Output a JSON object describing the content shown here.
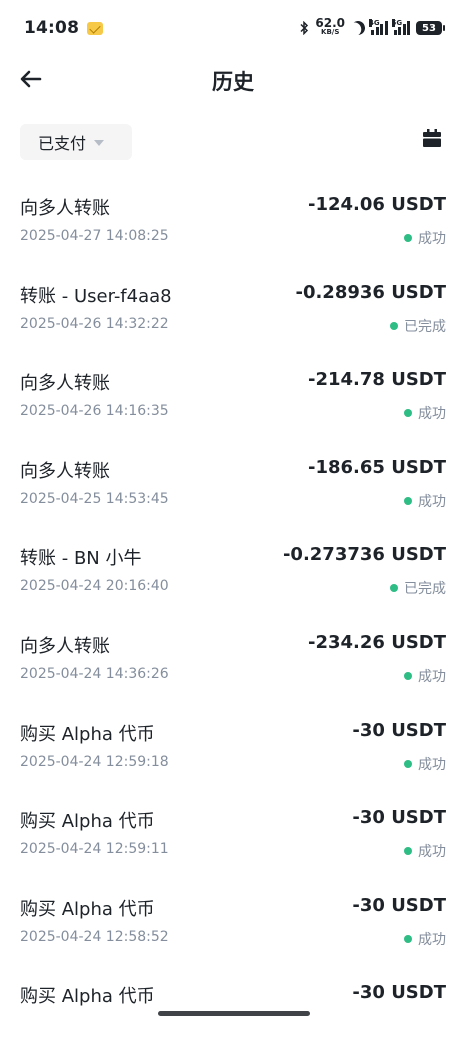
{
  "status_bar": {
    "time": "14:08",
    "net_speed": "62.0",
    "net_unit": "KB/S",
    "net_4g": "4G",
    "net_5g": "5G",
    "battery": "53"
  },
  "header": {
    "title": "历史"
  },
  "filter": {
    "label": "已支付"
  },
  "transactions": [
    {
      "title": "向多人转账",
      "amount": "-124.06 USDT",
      "time": "2025-04-27 14:08:25",
      "status": "成功"
    },
    {
      "title": "转账 - User-f4aa8",
      "amount": "-0.28936 USDT",
      "time": "2025-04-26 14:32:22",
      "status": "已完成"
    },
    {
      "title": "向多人转账",
      "amount": "-214.78 USDT",
      "time": "2025-04-26 14:16:35",
      "status": "成功"
    },
    {
      "title": "向多人转账",
      "amount": "-186.65 USDT",
      "time": "2025-04-25 14:53:45",
      "status": "成功"
    },
    {
      "title": "转账 - BN 小牛",
      "amount": "-0.273736 USDT",
      "time": "2025-04-24 20:16:40",
      "status": "已完成"
    },
    {
      "title": "向多人转账",
      "amount": "-234.26 USDT",
      "time": "2025-04-24 14:36:26",
      "status": "成功"
    },
    {
      "title": "购买 Alpha 代币",
      "amount": "-30 USDT",
      "time": "2025-04-24 12:59:18",
      "status": "成功"
    },
    {
      "title": "购买 Alpha 代币",
      "amount": "-30 USDT",
      "time": "2025-04-24 12:59:11",
      "status": "成功"
    },
    {
      "title": "购买 Alpha 代币",
      "amount": "-30 USDT",
      "time": "2025-04-24 12:58:52",
      "status": "成功"
    },
    {
      "title": "购买 Alpha 代币",
      "amount": "-30 USDT",
      "time": "",
      "status": ""
    }
  ],
  "colors": {
    "success": "#2ebd85",
    "text_primary": "#1e2329",
    "text_secondary": "#848e9c"
  },
  "icons": {
    "back": "back-arrow-icon",
    "calendar": "calendar-icon",
    "dropdown": "chevron-down-icon",
    "status": "status-dot-icon"
  }
}
